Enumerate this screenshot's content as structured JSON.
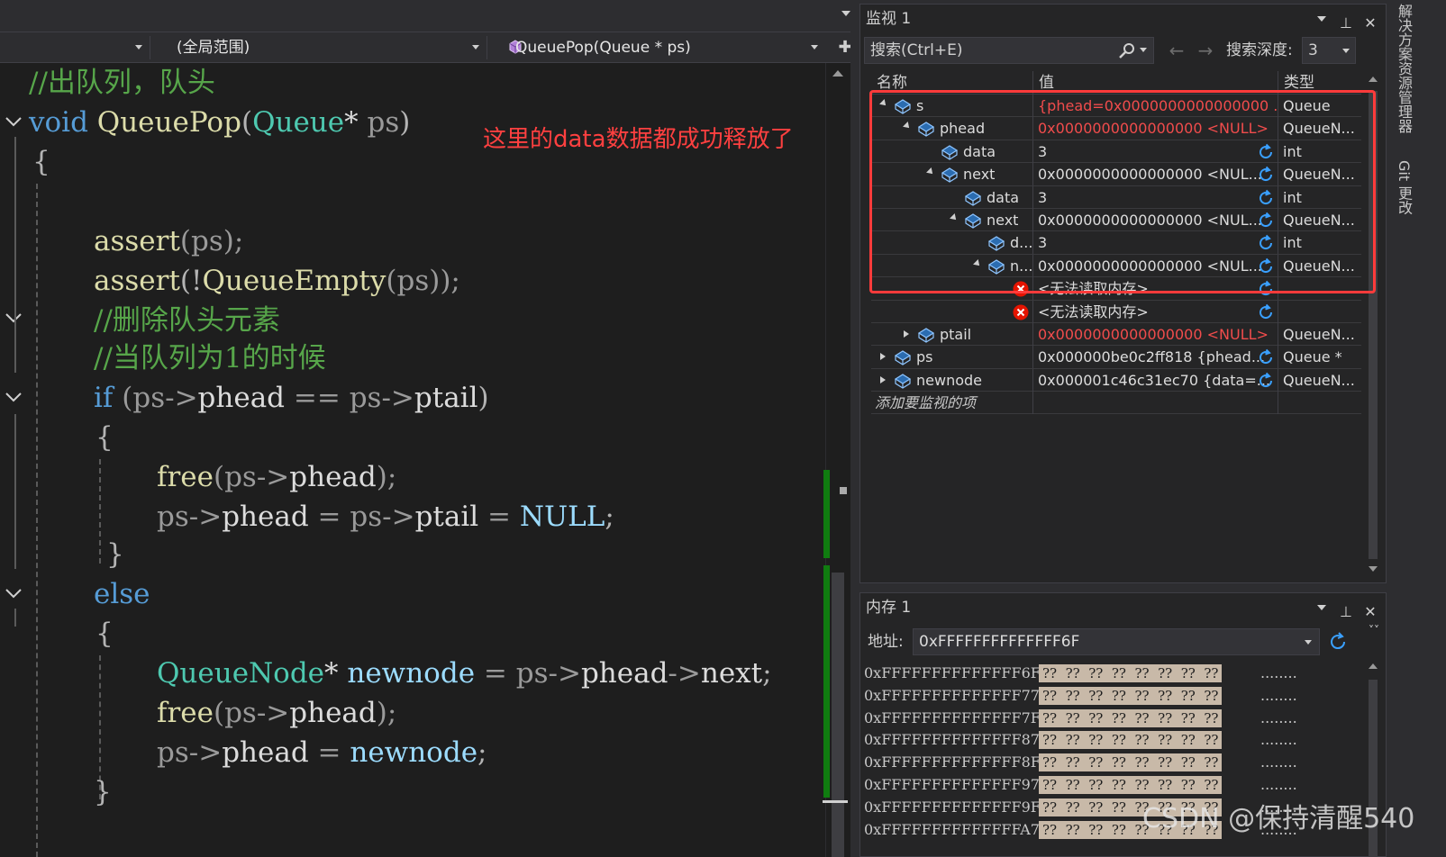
{
  "nav": {
    "scope": "(全局范围)",
    "function": "QueuePop(Queue * ps)"
  },
  "code": {
    "l0": "//出队列，队头",
    "l1_kw": "void",
    "l1_fn": "QueuePop",
    "l1_open": "(",
    "l1_type": "Queue",
    "l1_star": "*",
    "l1_param": "ps",
    "l1_close": ")",
    "l2": "{",
    "l4_fn": "assert",
    "l4_rest": "(ps);",
    "l5_fn": "assert",
    "l5_a": "(!",
    "l5_fn2": "QueueEmpty",
    "l5_b": "(ps));",
    "l6": "//删除队头元素",
    "l7": "//当队列为1的时候",
    "l8_kw": "if",
    "l8_a": "(ps->",
    "l8_b": "phead",
    "l8_c": " == ps->",
    "l8_d": "ptail",
    "l8_e": ")",
    "l9": "{",
    "l10_fn": "free",
    "l10_a": "(ps->",
    "l10_b": "phead",
    "l10_c": ");",
    "l11_a": "ps->",
    "l11_b": "phead",
    "l11_c": " = ps->",
    "l11_d": "ptail",
    "l11_e": " = ",
    "l11_f": "NULL",
    "l11_g": ";",
    "l12": "}",
    "l13_kw": "else",
    "l14": "{",
    "l15_type": "QueueNode",
    "l15_a": "* ",
    "l15_b": "newnode",
    "l15_c": " = ps->",
    "l15_d": "phead",
    "l15_e": "->",
    "l15_f": "next",
    "l15_g": ";",
    "l16_fn": "free",
    "l16_a": "(ps->",
    "l16_b": "phead",
    "l16_c": ");",
    "l17_a": "ps->",
    "l17_b": "phead",
    "l17_c": " = ",
    "l17_d": "newnode",
    "l17_e": ";",
    "l18": "}"
  },
  "annotation": "这里的data数据都成功释放了",
  "watch": {
    "title": "监视 1",
    "search_placeholder": "搜索(Ctrl+E)",
    "depth_label": "搜索深度:",
    "depth_value": "3",
    "col_name": "名称",
    "col_value": "值",
    "col_type": "类型",
    "rows": [
      {
        "name": "s",
        "value": "{phead=0x0000000000000000 ...",
        "type": "Queue"
      },
      {
        "name": "phead",
        "value": "0x0000000000000000 <NULL>",
        "type": "QueueN..."
      },
      {
        "name": "data",
        "value": "3",
        "type": "int"
      },
      {
        "name": "next",
        "value": "0x0000000000000000 <NUL...",
        "type": "QueueN..."
      },
      {
        "name": "data",
        "value": "3",
        "type": "int"
      },
      {
        "name": "next",
        "value": "0x0000000000000000 <NUL...",
        "type": "QueueN..."
      },
      {
        "name": "d...",
        "value": "3",
        "type": "int"
      },
      {
        "name": "n...",
        "value": "0x0000000000000000 <NUL...",
        "type": "QueueN..."
      },
      {
        "name": "",
        "value": "<无法读取内存>",
        "type": ""
      },
      {
        "name": "",
        "value": "<无法读取内存>",
        "type": ""
      },
      {
        "name": "ptail",
        "value": "0x0000000000000000 <NULL>",
        "type": "QueueN..."
      },
      {
        "name": "ps",
        "value": "0x000000be0c2ff818 {phead...",
        "type": "Queue *"
      },
      {
        "name": "newnode",
        "value": "0x000001c46c31ec70 {data=...",
        "type": "QueueN..."
      },
      {
        "name": "添加要监视的项",
        "value": "",
        "type": ""
      }
    ]
  },
  "memory": {
    "title": "内存 1",
    "addr_label": "地址:",
    "addr_value": "0xFFFFFFFFFFFFFF6F",
    "rows": [
      {
        "addr": "0xFFFFFFFFFFFFFF6F",
        "bytes": "??  ??  ??  ??  ??  ??  ??  ??",
        "ascii": "........"
      },
      {
        "addr": "0xFFFFFFFFFFFFFF77",
        "bytes": "??  ??  ??  ??  ??  ??  ??  ??",
        "ascii": "........"
      },
      {
        "addr": "0xFFFFFFFFFFFFFF7F",
        "bytes": "??  ??  ??  ??  ??  ??  ??  ??",
        "ascii": "........"
      },
      {
        "addr": "0xFFFFFFFFFFFFFF87",
        "bytes": "??  ??  ??  ??  ??  ??  ??  ??",
        "ascii": "........"
      },
      {
        "addr": "0xFFFFFFFFFFFFFF8F",
        "bytes": "??  ??  ??  ??  ??  ??  ??  ??",
        "ascii": "........"
      },
      {
        "addr": "0xFFFFFFFFFFFFFF97",
        "bytes": "??  ??  ??  ??  ??  ??  ??  ??",
        "ascii": "........"
      },
      {
        "addr": "0xFFFFFFFFFFFFFF9F",
        "bytes": "??  ??  ??  ??  ??  ??  ??  ??",
        "ascii": "........"
      },
      {
        "addr": "0xFFFFFFFFFFFFFFA7",
        "bytes": "??  ??  ??  ??  ??  ??  ??  ??",
        "ascii": "........"
      }
    ]
  },
  "side_tabs": [
    "解决方案资源管理器",
    "Git 更改"
  ],
  "watermark": "CSDN @保持清醒540",
  "colors": {
    "accent_red": "#ff3b3b",
    "change_bar": "#107c10",
    "comment": "#57a64a",
    "keyword": "#569cd6"
  }
}
